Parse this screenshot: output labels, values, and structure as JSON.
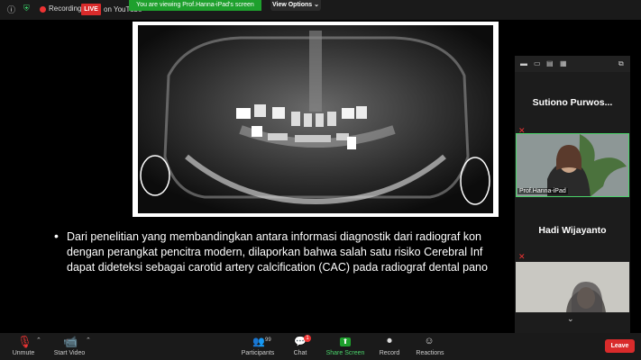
{
  "status_bar": {
    "recording_label": "Recording",
    "live_label": "LIVE",
    "youtube_label": "on YouTube",
    "viewing_banner": "You are viewing Prof.Hanna-iPad's screen",
    "view_options_label": "View Options"
  },
  "slide": {
    "bullet_lines": [
      "Dari penelitian yang membandingkan antara informasi diagnostik dari radiograf kon",
      "dengan perangkat pencitra modern, dilaporkan bahwa salah satu risiko Cerebral Inf",
      "dapat dideteksi sebagai carotid artery calcification (CAC) pada radiograf dental pano"
    ]
  },
  "participants": {
    "tiles": [
      {
        "name": "Sutiono  Purwos..."
      },
      {
        "name": "Prof.Hanna-iPad"
      },
      {
        "name": "Hadi Wijayanto"
      }
    ]
  },
  "toolbar": {
    "unmute_label": "Unmute",
    "start_video_label": "Start Video",
    "participants_label": "Participants",
    "participants_count": "99",
    "chat_label": "Chat",
    "chat_badge": "1",
    "share_label": "Share Screen",
    "record_label": "Record",
    "reactions_label": "Reactions",
    "leave_label": "Leave"
  },
  "colors": {
    "accent_green": "#1ea02d",
    "live_red": "#d92b2b",
    "background": "#000000"
  }
}
